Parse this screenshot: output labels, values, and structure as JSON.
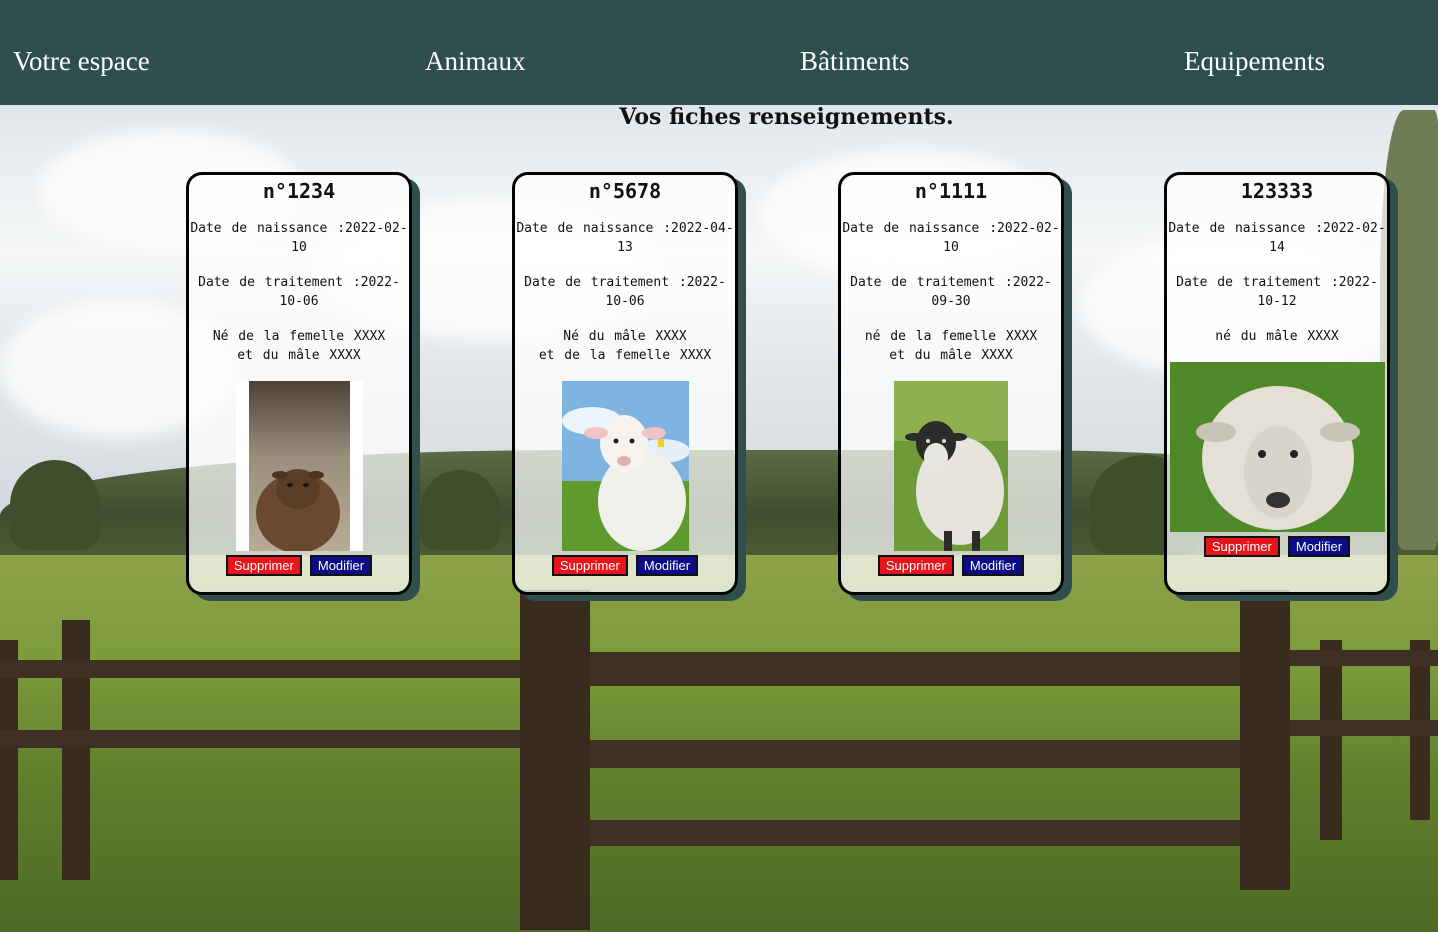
{
  "nav": {
    "items": [
      {
        "label": "Votre espace"
      },
      {
        "label": "Animaux"
      },
      {
        "label": "Bâtiments"
      },
      {
        "label": "Equipements"
      }
    ]
  },
  "page": {
    "title": "Vos fiches renseignements."
  },
  "cards": [
    {
      "title": "n°1234",
      "birth": "Date de naissance :2022-02-10",
      "treatment": "Date de traitement :2022-10-06",
      "parents": "Né de la femelle XXXX\net du mâle XXXX",
      "photo": "brown-sheep-photo",
      "delete_label": "Supprimer",
      "edit_label": "Modifier"
    },
    {
      "title": "n°5678",
      "birth": "Date de naissance :2022-04-13",
      "treatment": "Date de traitement :2022-10-06",
      "parents": "Né du mâle XXXX\net de la femelle XXXX",
      "photo": "white-lamb-photo",
      "delete_label": "Supprimer",
      "edit_label": "Modifier"
    },
    {
      "title": "n°1111",
      "birth": "Date de naissance :2022-02-10",
      "treatment": "Date de traitement :2022-09-30",
      "parents": "né de la femelle XXXX\net du mâle XXXX",
      "photo": "black-faced-sheep-photo",
      "delete_label": "Supprimer",
      "edit_label": "Modifier"
    },
    {
      "title": "123333",
      "birth": "Date de naissance :2022-02-14",
      "treatment": "Date de traitement :2022-10-12",
      "parents": "né du mâle XXXX",
      "photo": "woolly-ram-photo",
      "delete_label": "Supprimer",
      "edit_label": "Modifier"
    }
  ],
  "colors": {
    "nav_bg": "#2f4f4f",
    "delete_btn": "#e5151b",
    "edit_btn": "#0c0c86",
    "card_shadow": "#2f4f4f"
  }
}
